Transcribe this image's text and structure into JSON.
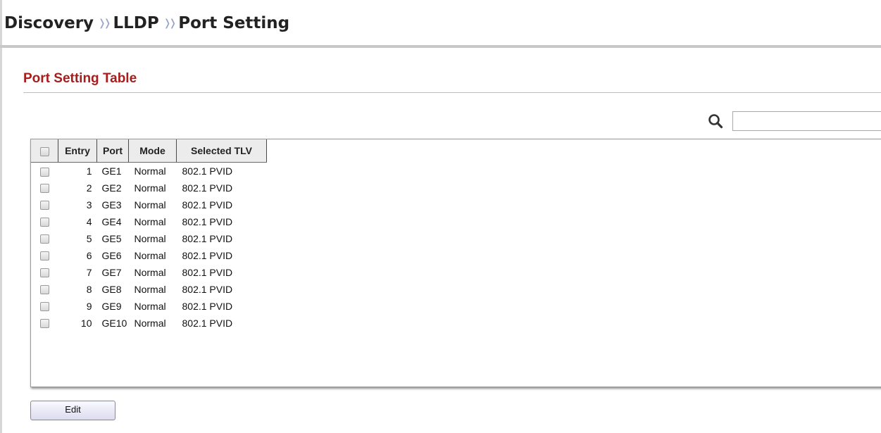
{
  "breadcrumb": {
    "items": [
      "Discovery",
      "LLDP",
      "Port Setting"
    ],
    "separator": "❭❭"
  },
  "section": {
    "title": "Port Setting Table"
  },
  "search": {
    "value": "",
    "placeholder": "",
    "icon": "search-icon"
  },
  "table": {
    "columns": [
      "",
      "Entry",
      "Port",
      "Mode",
      "Selected TLV"
    ],
    "rows": [
      {
        "entry": "1",
        "port": "GE1",
        "mode": "Normal",
        "tlv": "802.1 PVID"
      },
      {
        "entry": "2",
        "port": "GE2",
        "mode": "Normal",
        "tlv": "802.1 PVID"
      },
      {
        "entry": "3",
        "port": "GE3",
        "mode": "Normal",
        "tlv": "802.1 PVID"
      },
      {
        "entry": "4",
        "port": "GE4",
        "mode": "Normal",
        "tlv": "802.1 PVID"
      },
      {
        "entry": "5",
        "port": "GE5",
        "mode": "Normal",
        "tlv": "802.1 PVID"
      },
      {
        "entry": "6",
        "port": "GE6",
        "mode": "Normal",
        "tlv": "802.1 PVID"
      },
      {
        "entry": "7",
        "port": "GE7",
        "mode": "Normal",
        "tlv": "802.1 PVID"
      },
      {
        "entry": "8",
        "port": "GE8",
        "mode": "Normal",
        "tlv": "802.1 PVID"
      },
      {
        "entry": "9",
        "port": "GE9",
        "mode": "Normal",
        "tlv": "802.1 PVID"
      },
      {
        "entry": "10",
        "port": "GE10",
        "mode": "Normal",
        "tlv": "802.1 PVID"
      }
    ]
  },
  "buttons": {
    "edit_label": "Edit"
  },
  "colors": {
    "section_title": "#a81c1c",
    "separator": "#9aa4c8",
    "header_bg": "#ececec"
  }
}
